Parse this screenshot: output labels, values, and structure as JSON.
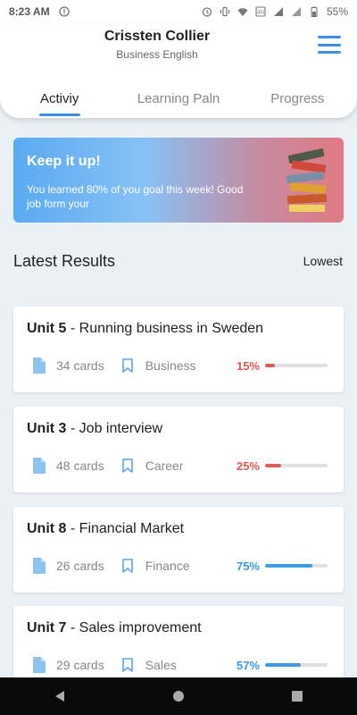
{
  "status_bar": {
    "time": "8:23 AM",
    "battery": "55%"
  },
  "header": {
    "name": "Crissten Collier",
    "subtitle": "Business English",
    "tabs": [
      {
        "label": "Activiy",
        "active": true
      },
      {
        "label": "Learning Paln",
        "active": false
      },
      {
        "label": "Progress",
        "active": false
      }
    ]
  },
  "promo": {
    "title": "Keep it up!",
    "message": "You learned 80% of you goal this week! Good job form your"
  },
  "results": {
    "title": "Latest Results",
    "sort_label": "Lowest",
    "items": [
      {
        "unit": "Unit 5",
        "name": " - Running business in Sweden",
        "cards": "34 cards",
        "category": "Business",
        "percent_label": "15%",
        "percent": 15,
        "color": "#e05a5a"
      },
      {
        "unit": "Unit 3",
        "name": " - Job interview",
        "cards": "48 cards",
        "category": "Career",
        "percent_label": "25%",
        "percent": 25,
        "color": "#e05a5a"
      },
      {
        "unit": "Unit 8",
        "name": " - Financial Market",
        "cards": "26 cards",
        "category": "Finance",
        "percent_label": "75%",
        "percent": 75,
        "color": "#3d9be0"
      },
      {
        "unit": "Unit 7",
        "name": " - Sales improvement",
        "cards": "29 cards",
        "category": "Sales",
        "percent_label": "57%",
        "percent": 57,
        "color": "#3d9be0"
      }
    ]
  },
  "colors": {
    "accent": "#3d8fe0",
    "low": "#e05a5a",
    "high": "#3d9be0"
  }
}
